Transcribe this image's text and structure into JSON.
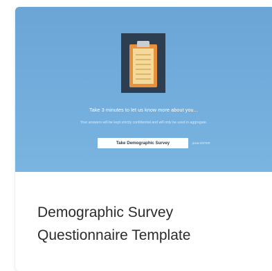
{
  "card": {
    "title_line1": "Demographic Survey",
    "title_line2": "Questionnaire Template",
    "thumbnail": {
      "icon": "clipboard-icon",
      "heading": "Take 3 minutes to let us know more about you...",
      "subtext": "Your answers will be kept strictly confidential and will only be used in aggregate.",
      "button_label": "Take Demographic Survey",
      "hint": "press ENTER",
      "background_color": "#6aa5d6"
    }
  }
}
